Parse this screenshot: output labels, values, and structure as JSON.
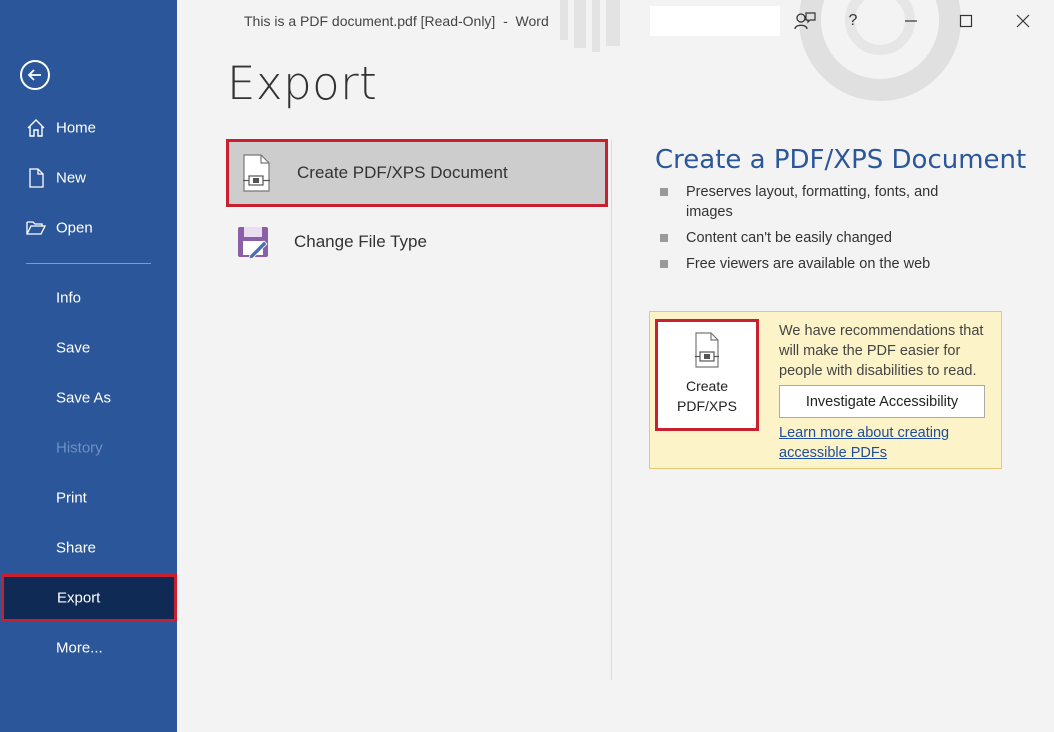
{
  "window": {
    "title": "This is a PDF document.pdf [Read-Only]  -  Word",
    "buttons": {
      "coauthor": "coauthor-icon",
      "help": "?",
      "minimize": "minimize-icon",
      "restore": "restore-icon",
      "close": "close-icon"
    }
  },
  "sidebar": {
    "back_icon": "back-arrow-icon",
    "items": [
      {
        "label": "Home",
        "icon": "home-icon"
      },
      {
        "label": "New",
        "icon": "new-document-icon"
      },
      {
        "label": "Open",
        "icon": "folder-open-icon"
      },
      {
        "label": "Info"
      },
      {
        "label": "Save"
      },
      {
        "label": "Save As"
      },
      {
        "label": "History",
        "disabled": true
      },
      {
        "label": "Print"
      },
      {
        "label": "Share"
      },
      {
        "label": "Export",
        "active": true
      },
      {
        "label": "More..."
      }
    ]
  },
  "main": {
    "title": "Export",
    "options": [
      {
        "label": "Create PDF/XPS Document",
        "icon": "pdf-document-icon",
        "selected": true
      },
      {
        "label": "Change File Type",
        "icon": "change-file-type-icon"
      }
    ],
    "detail": {
      "title": "Create a PDF/XPS Document",
      "bullets": [
        "Preserves layout, formatting, fonts, and images",
        "Content can't be easily changed",
        "Free viewers are available on the web"
      ],
      "recommendation": {
        "create_button_line1": "Create",
        "create_button_line2": "PDF/XPS",
        "text": "We have recommendations that will make the PDF easier for people with disabilities to read.",
        "investigate_button": "Investigate Accessibility",
        "learn_more_link": "Learn more about creating accessible PDFs"
      }
    }
  },
  "colors": {
    "sidebar_bg": "#2b579a",
    "active_bg": "#0e2a55",
    "highlight_border": "#c8202c",
    "accent_text": "#2b579a",
    "recommendation_bg": "#fdf3c8"
  }
}
